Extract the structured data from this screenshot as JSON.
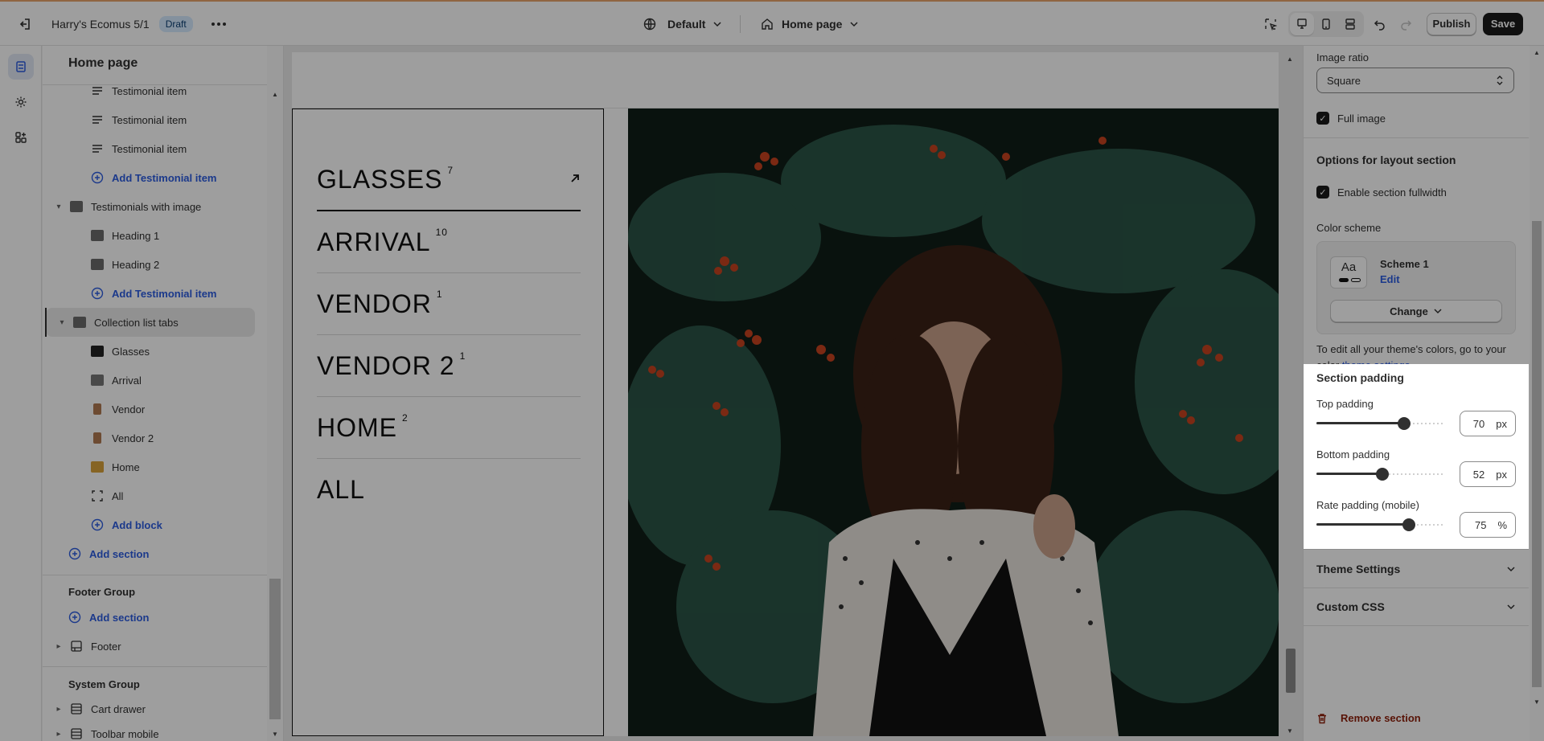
{
  "topbar": {
    "store_name": "Harry's Ecomus 5/1",
    "status_badge": "Draft",
    "theme_selector": "Default",
    "page_selector": "Home page",
    "publish_label": "Publish",
    "save_label": "Save"
  },
  "sidebar": {
    "title": "Home page",
    "rows": [
      {
        "label": "Testimonial item"
      },
      {
        "label": "Testimonial item"
      },
      {
        "label": "Testimonial item"
      },
      {
        "label": "Add Testimonial item"
      },
      {
        "label": "Testimonials with image"
      },
      {
        "label": "Heading 1"
      },
      {
        "label": "Heading 2"
      },
      {
        "label": "Add Testimonial item"
      },
      {
        "label": "Collection list tabs"
      },
      {
        "label": "Glasses"
      },
      {
        "label": "Arrival"
      },
      {
        "label": "Vendor"
      },
      {
        "label": "Vendor 2"
      },
      {
        "label": "Home"
      },
      {
        "label": "All"
      },
      {
        "label": "Add block"
      },
      {
        "label": "Add section"
      }
    ],
    "footer_group": {
      "title": "Footer Group",
      "add_label": "Add section",
      "footer_label": "Footer"
    },
    "system_group": {
      "title": "System Group",
      "cart_label": "Cart drawer",
      "toolbar_label": "Toolbar mobile"
    }
  },
  "preview": {
    "tabs": [
      {
        "label": "GLASSES",
        "count": "7"
      },
      {
        "label": "ARRIVAL",
        "count": "10"
      },
      {
        "label": "VENDOR",
        "count": "1"
      },
      {
        "label": "VENDOR 2",
        "count": "1"
      },
      {
        "label": "HOME",
        "count": "2"
      },
      {
        "label": "ALL",
        "count": ""
      }
    ]
  },
  "panel": {
    "image_ratio_label": "Image ratio",
    "image_ratio_value": "Square",
    "full_image_label": "Full image",
    "layout_heading": "Options for layout section",
    "fullwidth_label": "Enable section fullwidth",
    "color_scheme_label": "Color scheme",
    "scheme_name": "Scheme 1",
    "scheme_edit": "Edit",
    "scheme_preview": "Aa",
    "change_label": "Change",
    "help_text": "To edit all your theme's colors, go to your color",
    "help_link": "theme settings",
    "padding_heading": "Section padding",
    "top_padding_label": "Top padding",
    "top_padding_value": "70",
    "top_padding_unit": "px",
    "top_padding_fraction": 0.68,
    "bottom_padding_label": "Bottom padding",
    "bottom_padding_value": "52",
    "bottom_padding_unit": "px",
    "bottom_padding_fraction": 0.51,
    "rate_padding_label": "Rate padding (mobile)",
    "rate_padding_value": "75",
    "rate_padding_unit": "%",
    "rate_padding_fraction": 0.72,
    "theme_settings_label": "Theme Settings",
    "custom_css_label": "Custom CSS",
    "remove_label": "Remove section"
  },
  "colors": {
    "accent_link": "#2c5ce0",
    "danger": "#8e1f0b",
    "draft_badge_bg": "#d5ebff"
  }
}
